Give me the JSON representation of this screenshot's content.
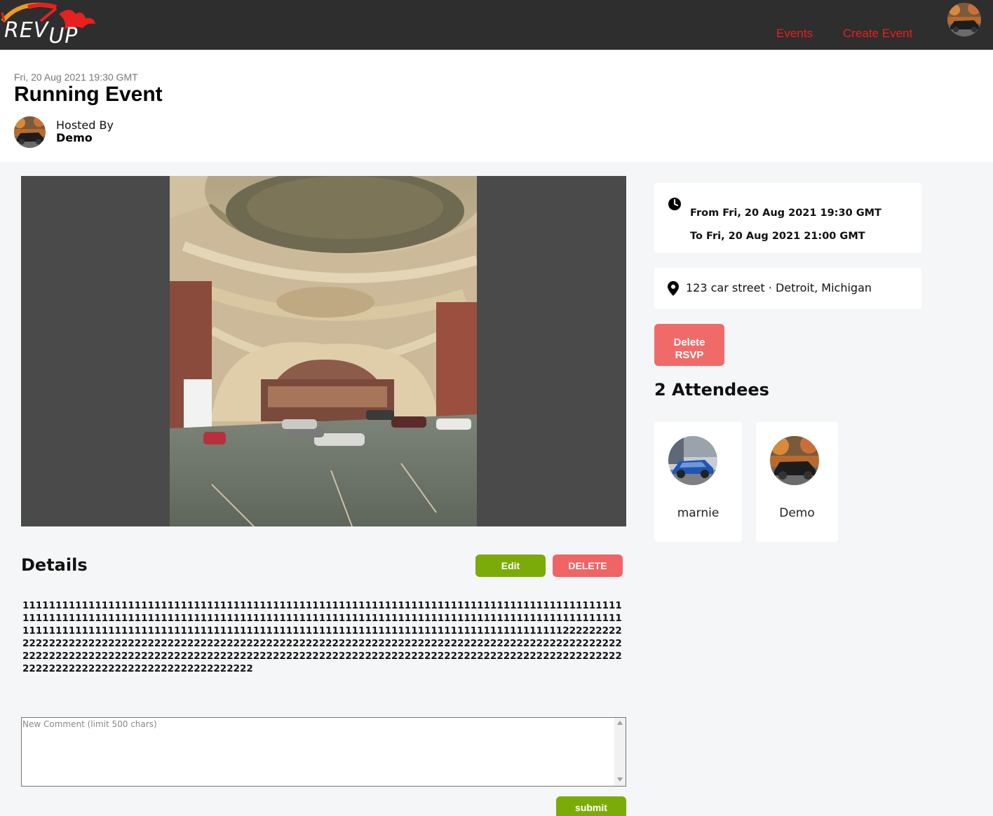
{
  "navbar": {
    "logo_text": "REV",
    "logo_text_2": "UP",
    "links": [
      "Events",
      "Create Event"
    ],
    "accent_color": "#e8201e",
    "background_color": "#2e2e2e"
  },
  "event": {
    "date": "Fri, 20 Aug 2021 19:30 GMT",
    "title": "Running Event",
    "hosted_by_label": "Hosted By",
    "host_name": "Demo"
  },
  "details": {
    "heading": "Details",
    "edit_label": "Edit",
    "delete_label": "DELETE",
    "text": "1111111111111111111111111111111111111111111111111111111111111111111111111111111111111111111111111111111111111111111111111111111111111111111111111111111111111111111111111111111111111111111111111111111111111111111111111111111111111111111111111111111111111111111111112222222222222222222222222222222222222222222222222222222222222222222222222222222222222222222222222222222222222222222222222222222222222222222222222222222222222222222222222222222222222222222222222222222222222222222222222222222222"
  },
  "comment": {
    "placeholder": "New Comment (limit 500 chars)",
    "submit_label": "submit"
  },
  "sidebar": {
    "time_from": "From Fri, 20 Aug 2021 19:30 GMT",
    "time_to": "To Fri, 20 Aug 2021 21:00 GMT",
    "location": "123 car street · Detroit, Michigan",
    "rsvp_label_1": "Delete",
    "rsvp_label_2": "RSVP",
    "attendees_heading": "2 Attendees",
    "attendees": [
      {
        "name": "marnie",
        "avatar": "blue-car-avatar"
      },
      {
        "name": "Demo",
        "avatar": "black-car-avatar"
      }
    ]
  },
  "colors": {
    "green": "#7bab08",
    "red": "#ef6464",
    "page_bg": "#f5f6f7"
  }
}
